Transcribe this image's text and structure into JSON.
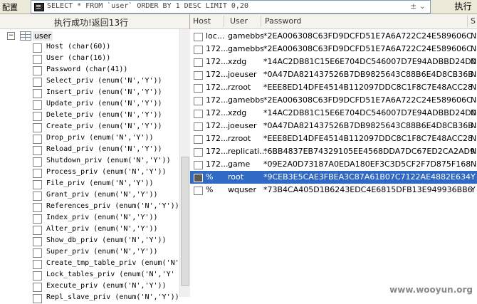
{
  "toolbar": {
    "config_label": "配置",
    "query": "SELECT * FROM `user` ORDER BY 1 DESC LIMIT 0,20",
    "query_controls": "±  ⌄",
    "execute_label": "执行"
  },
  "left": {
    "status": "执行成功!返回13行",
    "tree_root_expander": "−",
    "table_name": "user",
    "columns": [
      "Host (char(60))",
      "User (char(16))",
      "Password (char(41))",
      "Select_priv (enum('N','Y'))",
      "Insert_priv (enum('N','Y'))",
      "Update_priv (enum('N','Y'))",
      "Delete_priv (enum('N','Y'))",
      "Create_priv (enum('N','Y'))",
      "Drop_priv (enum('N','Y'))",
      "Reload_priv (enum('N','Y'))",
      "Shutdown_priv (enum('N','Y'))",
      "Process_priv (enum('N','Y'))",
      "File_priv (enum('N','Y'))",
      "Grant_priv (enum('N','Y'))",
      "References_priv (enum('N','Y'))",
      "Index_priv (enum('N','Y'))",
      "Alter_priv (enum('N','Y'))",
      "Show_db_priv (enum('N','Y'))",
      "Super_priv (enum('N','Y'))",
      "Create_tmp_table_priv (enum('N'",
      "Lock_tables_priv (enum('N','Y'",
      "Execute_priv (enum('N','Y'))",
      "Repl_slave_priv (enum('N','Y'))"
    ]
  },
  "grid": {
    "headers": [
      "Host",
      "User",
      "Password",
      "S"
    ],
    "rows": [
      {
        "host": "loc...",
        "user": "gamebbs",
        "password": "*2EA006308C63FD9DCFD51E7A6A722C24E589606C",
        "sel": "N"
      },
      {
        "host": "172...",
        "user": "gamebbs",
        "password": "*2EA006308C63FD9DCFD51E7A6A722C24E589606C",
        "sel": "N"
      },
      {
        "host": "172...",
        "user": "xzdg",
        "password": "*14AC2DB81C15E6E704DC546007D7E94ADBBD24D0",
        "sel": "N"
      },
      {
        "host": "172...",
        "user": "joeuser",
        "password": "*0A47DA821437526B7DB9825643C88B6E4D8CB36B",
        "sel": "N"
      },
      {
        "host": "172...",
        "user": "rzroot",
        "password": "*EEE8ED14DFE4514B112097DDC8C1F8C7E48ACC28",
        "sel": "N"
      },
      {
        "host": "172...",
        "user": "gamebbs",
        "password": "*2EA006308C63FD9DCFD51E7A6A722C24E589606C",
        "sel": "N"
      },
      {
        "host": "172...",
        "user": "xzdg",
        "password": "*14AC2DB81C15E6E704DC546007D7E94ADBBD24D0",
        "sel": "N"
      },
      {
        "host": "172...",
        "user": "joeuser",
        "password": "*0A47DA821437526B7DB9825643C88B6E4D8CB36B",
        "sel": "N"
      },
      {
        "host": "172...",
        "user": "rzroot",
        "password": "*EEE8ED14DFE4514B112097DDC8C1F8C7E48ACC28",
        "sel": "N"
      },
      {
        "host": "172...",
        "user": "replicati...",
        "password": "*6BB4837EB74329105EE4568DDA7DC67ED2CA2AD9",
        "sel": "N"
      },
      {
        "host": "172...",
        "user": "game",
        "password": "*09E2A0D73187A0EDA180EF3C3D5CF2F7D875F168",
        "sel": "N"
      },
      {
        "host": "%",
        "user": "root",
        "password": "*9CEB3E5CAE3FBEA3C87A61B07C7122AE4882E634",
        "sel": "Y"
      },
      {
        "host": "%",
        "user": "wquser",
        "password": "*73B4CA405D1B6243EDC4E6815DFB13E949936BB6",
        "sel": "Y"
      }
    ],
    "selected_row": 11
  },
  "watermark": "www.wooyun.org"
}
